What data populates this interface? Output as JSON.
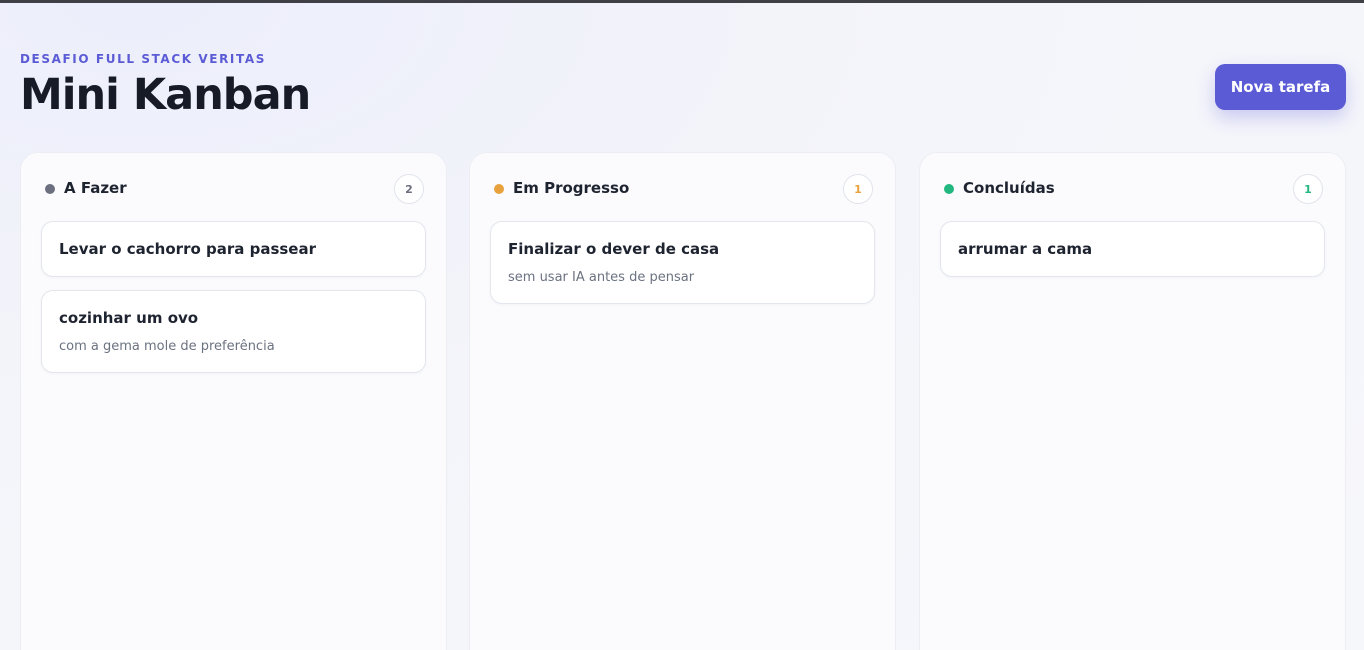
{
  "header": {
    "eyebrow": "DESAFIO FULL STACK VERITAS",
    "title": "Mini Kanban",
    "new_task_label": "Nova tarefa"
  },
  "colors": {
    "accent": "#5b5bd6",
    "todo": "#6b6f80",
    "progress": "#e8a23d",
    "done": "#22b77e"
  },
  "columns": [
    {
      "title": "A Fazer",
      "count": "2",
      "cards": [
        {
          "title": "Levar o cachorro para passear",
          "desc": ""
        },
        {
          "title": "cozinhar um ovo",
          "desc": "com a gema mole de preferência"
        }
      ]
    },
    {
      "title": "Em Progresso",
      "count": "1",
      "cards": [
        {
          "title": "Finalizar o dever de casa",
          "desc": "sem usar IA antes de pensar"
        }
      ]
    },
    {
      "title": "Concluídas",
      "count": "1",
      "cards": [
        {
          "title": "arrumar a cama",
          "desc": ""
        }
      ]
    }
  ]
}
